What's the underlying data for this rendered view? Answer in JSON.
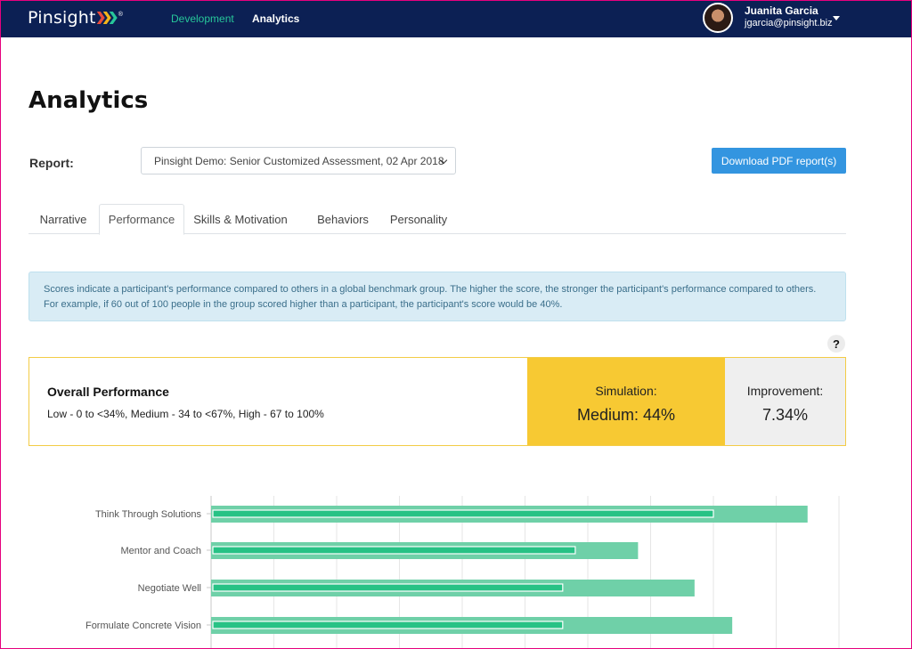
{
  "nav": {
    "logo": "Pinsight",
    "logo_reg": "®",
    "logo_colors": [
      "#e84b3c",
      "#f4b41a",
      "#27c79a"
    ],
    "items": [
      {
        "label": "Development",
        "active": false
      },
      {
        "label": "Analytics",
        "active": true
      }
    ],
    "user": {
      "name": "Juanita Garcia",
      "email": "jgarcia@pinsight.biz"
    }
  },
  "page": {
    "title": "Analytics"
  },
  "report": {
    "label": "Report:",
    "selected": "Pinsight Demo: Senior Customized Assessment, 02 Apr 2018",
    "download_label": "Download PDF report(s)"
  },
  "tabs": [
    {
      "label": "Narrative",
      "active": false
    },
    {
      "label": "Performance",
      "active": true
    },
    {
      "label": "Skills & Motivation",
      "active": false
    },
    {
      "label": "Behaviors",
      "active": false
    },
    {
      "label": "Personality",
      "active": false
    }
  ],
  "info": {
    "text": "Scores indicate a participant's performance compared to others in a global benchmark group. The higher the score, the stronger the participant's performance compared to others. For example, if 60 out of 100 people in the group scored higher than a participant, the participant's score would be 40%."
  },
  "help": {
    "label": "?"
  },
  "overall": {
    "title": "Overall Performance",
    "ranges": "Low - 0 to <34%, Medium - 34 to <67%, High - 67 to 100%",
    "simulation_label": "Simulation:",
    "simulation_value": "Medium: 44%",
    "improvement_label": "Improvement:",
    "improvement_value": "7.34%",
    "colors": {
      "simulation": "#f7c933",
      "improvement": "#efefef",
      "border": "#f3cc46"
    }
  },
  "chart_data": {
    "type": "bar",
    "orientation": "horizontal",
    "categories": [
      "Think Through Solutions",
      "Mentor and Coach",
      "Negotiate Well",
      "Formulate Concrete Vision"
    ],
    "series": [
      {
        "values": [
          95,
          68,
          77,
          83
        ],
        "color": "#6fd0a8"
      },
      {
        "values": [
          80,
          58,
          56,
          56
        ],
        "color": "#27c285"
      }
    ],
    "xlim": [
      0,
      100
    ],
    "grid": true
  }
}
